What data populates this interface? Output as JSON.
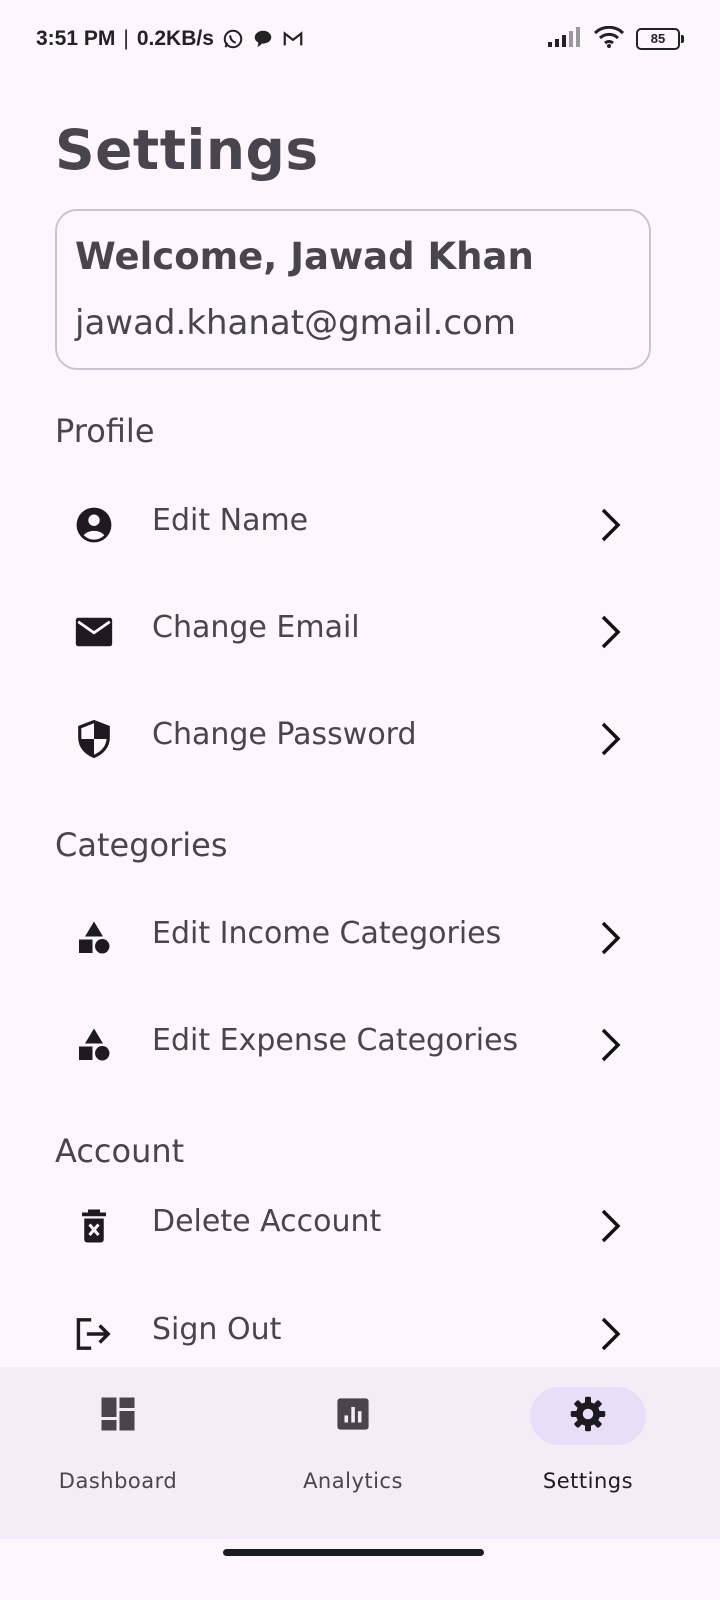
{
  "status_bar": {
    "time": "3:51 PM",
    "separator": "|",
    "speed": "0.2KB/s",
    "battery": "85",
    "left_icons": [
      "whatsapp-icon",
      "chat-bubble-icon",
      "gmail-icon"
    ],
    "right_icons": [
      "signal-icon",
      "wifi-icon",
      "battery-icon"
    ]
  },
  "page": {
    "title": "Settings"
  },
  "welcome": {
    "name": "Welcome, Jawad Khan",
    "email": "jawad.khanat@gmail.com"
  },
  "sections": {
    "profile": {
      "title": "Profile",
      "items": [
        {
          "label": "Edit Name",
          "icon": "account-circle-icon"
        },
        {
          "label": "Change Email",
          "icon": "mail-icon"
        },
        {
          "label": "Change Password",
          "icon": "shield-icon"
        }
      ]
    },
    "categories": {
      "title": "Categories",
      "items": [
        {
          "label": "Edit Income Categories",
          "icon": "shapes-icon"
        },
        {
          "label": "Edit Expense Categories",
          "icon": "shapes-icon"
        }
      ]
    },
    "account": {
      "title": "Account",
      "items": [
        {
          "label": "Delete Account",
          "icon": "delete-icon"
        },
        {
          "label": "Sign Out",
          "icon": "logout-icon"
        }
      ]
    }
  },
  "bottom_nav": {
    "items": [
      {
        "label": "Dashboard",
        "icon": "dashboard-icon",
        "active": false
      },
      {
        "label": "Analytics",
        "icon": "analytics-icon",
        "active": false
      },
      {
        "label": "Settings",
        "icon": "gear-icon",
        "active": true
      }
    ]
  },
  "colors": {
    "background": "#fdf6fc",
    "text": "#49454f",
    "nav_background": "#f3edf7",
    "nav_active_pill": "#e8def8"
  }
}
